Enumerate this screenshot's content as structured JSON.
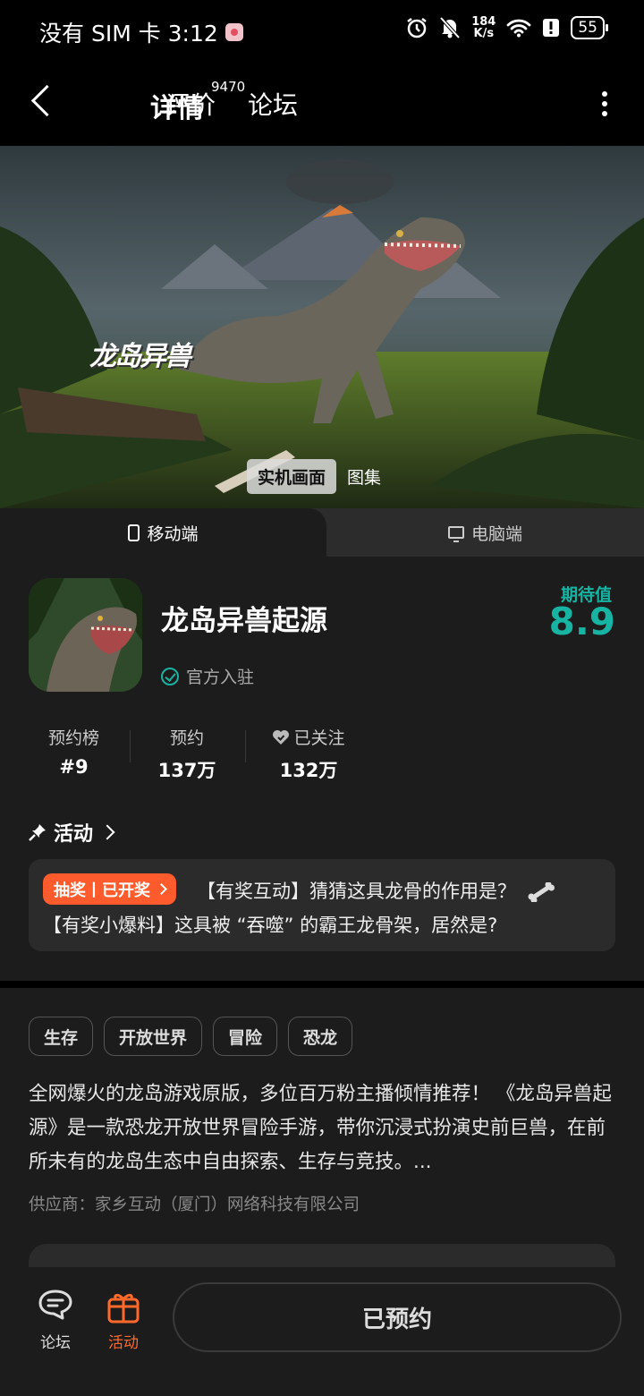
{
  "status_bar": {
    "carrier_time": "没有 SIM 卡 3:12",
    "net_speed_value": "184",
    "net_speed_unit": "K/s",
    "battery": "55"
  },
  "nav": {
    "tabs": [
      {
        "label": "详情",
        "active": true
      },
      {
        "label": "评价"
      },
      {
        "label": "论坛"
      }
    ],
    "review_count": "9470",
    "accent_color": "#17b3a3"
  },
  "hero": {
    "logo_text": "龙岛异兽",
    "media_tabs": [
      {
        "label": "实机画面",
        "active": true
      },
      {
        "label": "图集"
      }
    ]
  },
  "platform_tabs": [
    {
      "label": "移动端",
      "icon": "phone-icon",
      "active": true
    },
    {
      "label": "电脑端",
      "icon": "monitor-icon"
    }
  ],
  "app": {
    "name": "龙岛异兽起源",
    "official_label": "官方入驻",
    "expect_label": "期待值",
    "expect_score": "8.9"
  },
  "stats": [
    {
      "label": "预约榜",
      "value": "#9"
    },
    {
      "label": "预约",
      "value": "137万"
    },
    {
      "label": "已关注",
      "value": "132万"
    }
  ],
  "activity": {
    "title": "活动",
    "badge": "抽奖丨已开奖",
    "line1": "【有奖互动】猜猜这具龙骨的作用是？",
    "line2": "【有奖小爆料】这具被 “吞噬” 的霸王龙骨架，居然是?"
  },
  "tags": [
    "生存",
    "开放世界",
    "冒险",
    "恐龙"
  ],
  "description": "全网爆火的龙岛游戏原版，多位百万粉主播倾情推荐！ 《龙岛异兽起源》是一款恐龙开放世界冒险手游，带你沉浸式扮演史前巨兽，在前所未有的龙岛生态中自由探索、生存与竞技。...",
  "supplier": "供应商：家乡互动（厦门）网络科技有限公司",
  "bottom_bar": {
    "forum_label": "论坛",
    "activity_label": "活动",
    "reserve_button": "已预约",
    "activity_color": "#ff6a2b"
  }
}
